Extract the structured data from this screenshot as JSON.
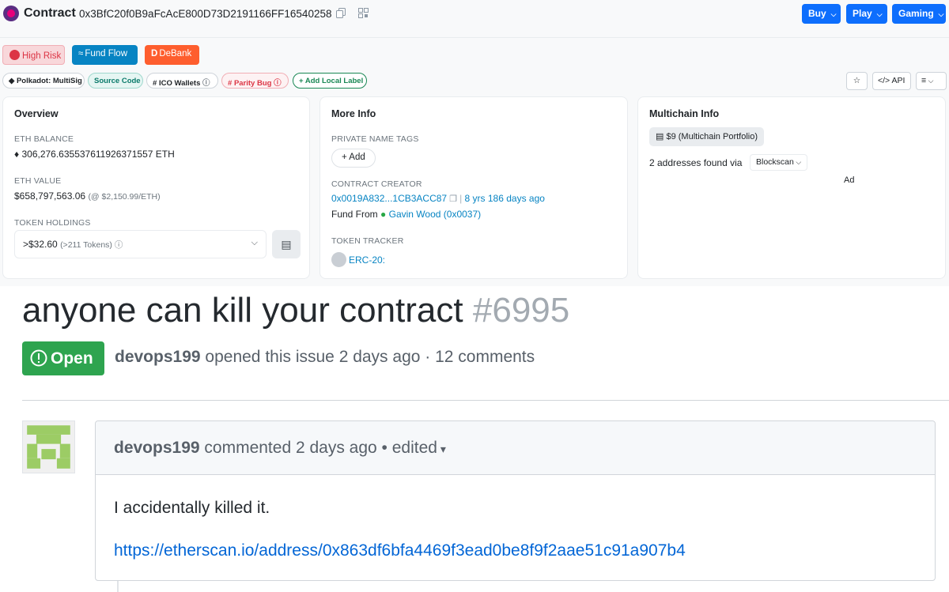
{
  "header": {
    "title": "Contract",
    "address": "0x3BfC20f0B9aFcAcE800D73D2191166FF16540258",
    "buttons": [
      {
        "label": "Buy"
      },
      {
        "label": "Play"
      },
      {
        "label": "Gaming"
      }
    ]
  },
  "tags": {
    "high_risk": "High Risk",
    "fund_flow": "Fund Flow",
    "debank": "DeBank",
    "labels": [
      "Polkadot: MultiSig",
      "Source Code",
      "ICO Wallets",
      "Parity Bug"
    ],
    "add_label": "Add Local Label",
    "api": "API"
  },
  "overview": {
    "title": "Overview",
    "eth_balance_label": "ETH BALANCE",
    "eth_balance": "306,276.635537611926371557 ETH",
    "eth_value_label": "ETH VALUE",
    "eth_value": "$658,797,563.06",
    "eth_price": "(@ $2,150.99/ETH)",
    "token_holdings_label": "TOKEN HOLDINGS",
    "token_value": ">$32.60",
    "token_count": "(>211 Tokens)"
  },
  "more_info": {
    "title": "More Info",
    "private_tags_label": "PRIVATE NAME TAGS",
    "add_label": "Add",
    "creator_label": "CONTRACT CREATOR",
    "creator_addr": "0x0019A832...1CB3ACC87",
    "creator_age": "8 yrs 186 days ago",
    "fund_from_label": "Fund From",
    "fund_from": "Gavin Wood (0x0037)",
    "token_tracker_label": "TOKEN TRACKER",
    "token_tracker": "ERC-20:"
  },
  "multichain": {
    "title": "Multichain Info",
    "portfolio": "$9 (Multichain Portfolio)",
    "found_text": "2 addresses found via",
    "source": "Blockscan",
    "ad": "Ad"
  },
  "issue": {
    "title": "anyone can kill your contract",
    "number": "#6995",
    "state": "Open",
    "author": "devops199",
    "meta_text": "opened this issue 2 days ago · 12 comments",
    "comment_author": "devops199",
    "comment_meta": "commented 2 days ago • edited",
    "comment_body": "I accidentally killed it.",
    "comment_link": "https://etherscan.io/address/0x863df6bfa4469f3ead0be8f9f2aae51c91a907b4"
  },
  "colors": {
    "primary": "#0d6efd",
    "open_green": "#2ea44f",
    "debank": "#fe5e2e",
    "link": "#0366d6"
  }
}
